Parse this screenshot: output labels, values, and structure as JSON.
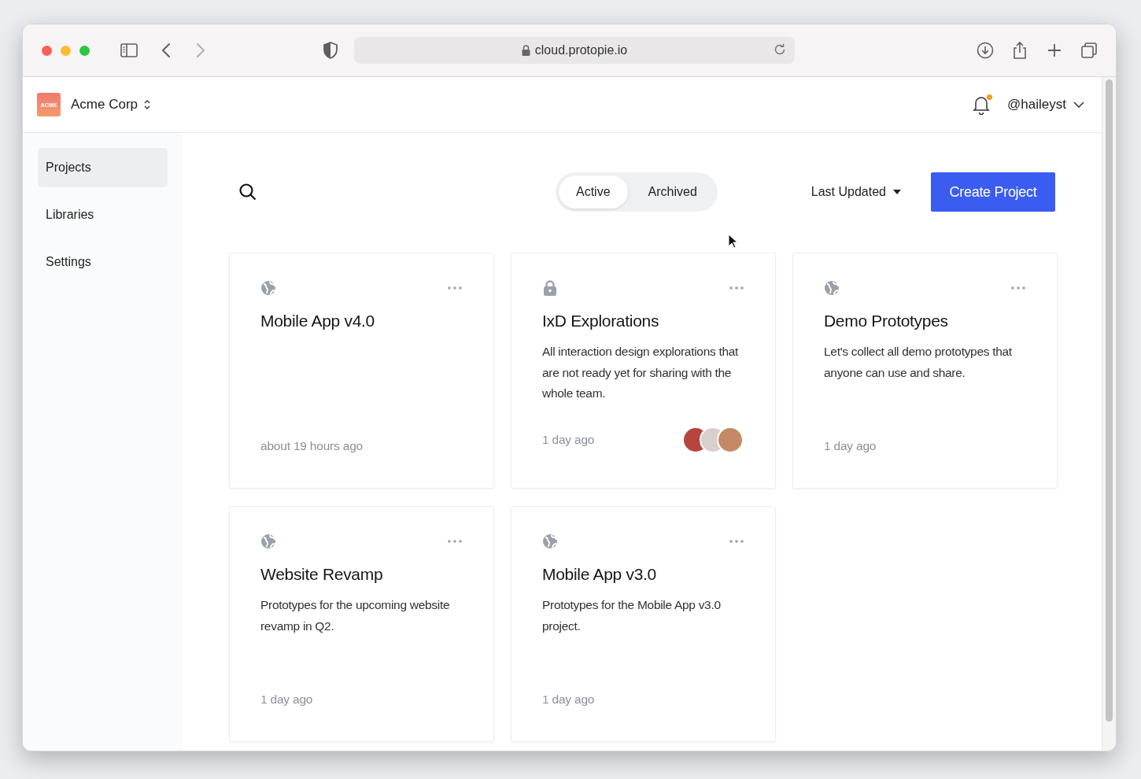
{
  "browser": {
    "url": "cloud.protopie.io"
  },
  "header": {
    "workspace_logo": "ACME",
    "workspace": "Acme Corp",
    "notification": {
      "unread": true
    },
    "user": "@haileyst"
  },
  "sidebar": {
    "items": [
      {
        "label": "Projects",
        "selected": true
      },
      {
        "label": "Libraries",
        "selected": false
      },
      {
        "label": "Settings",
        "selected": false
      }
    ]
  },
  "toolbar": {
    "tabs": [
      {
        "label": "Active",
        "selected": true
      },
      {
        "label": "Archived",
        "selected": false
      }
    ],
    "sort": "Last Updated",
    "create_button": "Create Project"
  },
  "projects": [
    {
      "kind": "public",
      "title": "Mobile App v4.0",
      "updated": "about 19 hours ago"
    },
    {
      "kind": "private",
      "title": "IxD Explorations",
      "description": "All interaction design explorations that are not ready yet for sharing with the whole team.",
      "updated": "1 day ago",
      "avatars": [
        {
          "color": "#b8453d"
        },
        {
          "color": "#d9cfcb"
        },
        {
          "color": "#c48a66"
        }
      ]
    },
    {
      "kind": "public",
      "title": "Demo Prototypes",
      "description": "Let's collect all demo prototypes that anyone can use and share.",
      "updated": "1 day ago"
    },
    {
      "kind": "public",
      "title": "Website Revamp",
      "description": "Prototypes for the upcoming website revamp in Q2.",
      "updated": "1 day ago"
    },
    {
      "kind": "public",
      "title": "Mobile App v3.0",
      "description": "Prototypes for the Mobile App v3.0 project.",
      "updated": "1 day ago"
    }
  ]
}
